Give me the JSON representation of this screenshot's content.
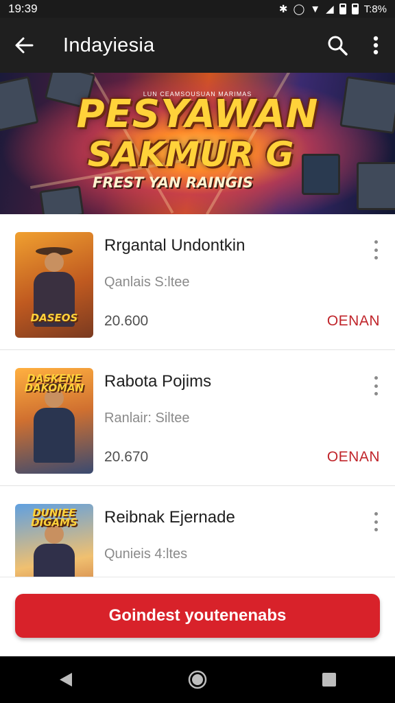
{
  "status_bar": {
    "time": "19:39",
    "battery_text": "T:8%",
    "icons": [
      "bluetooth-icon",
      "alarm-icon",
      "wifi-icon",
      "signal-icon",
      "battery-icon"
    ]
  },
  "app_bar": {
    "title": "Indayiesia",
    "icons": [
      "back-arrow-icon",
      "search-icon",
      "more-vert-icon"
    ]
  },
  "banner": {
    "eyebrow": "LUN CEAMSOUSUAN MARIMAS",
    "line1": "PESYAWAN",
    "line2": "SAKMUR G",
    "line3": "FREST YAN RAINGIS"
  },
  "items": [
    {
      "name": "Rrgantal Undontkin",
      "subtitle": "Qanlais S:ltee",
      "price": "20.600",
      "action": "OENAN",
      "thumb_logo": "DASEOS",
      "thumb_logo_sub": "",
      "thumb_colors": [
        "#f0a030",
        "#7a3a20"
      ]
    },
    {
      "name": "Rabota Pojims",
      "subtitle": "Ranlair: Siltee",
      "price": "20.670",
      "action": "OENAN",
      "thumb_logo": "DASKENE",
      "thumb_logo_sub": "DAKOMAN",
      "thumb_colors": [
        "#ffb040",
        "#3a4a70"
      ]
    },
    {
      "name": "Reibnak Ejernade",
      "subtitle": "Qunieis 4:ltes",
      "price": "",
      "action": "",
      "thumb_logo": "DUNIEE",
      "thumb_logo_sub": "DIGAMS",
      "thumb_colors": [
        "#60a0e0",
        "#c06030"
      ]
    }
  ],
  "cta": {
    "label": "Goindest youtenenabs"
  },
  "nav_bar": {
    "icons": [
      "back-triangle-icon",
      "home-circle-icon",
      "recents-square-icon"
    ]
  },
  "colors": {
    "accent": "#d8222a",
    "app_bar": "#1f1f1f",
    "status_bar": "#1b1b1b"
  }
}
